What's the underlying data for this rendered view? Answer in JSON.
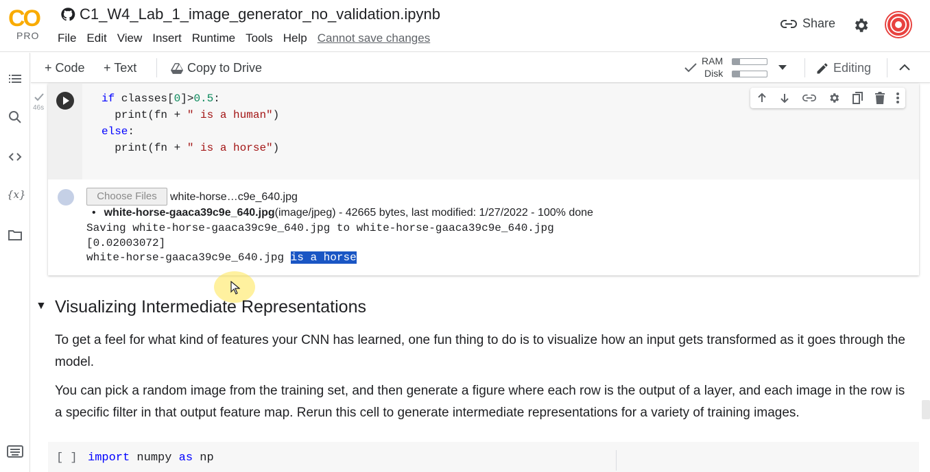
{
  "app": {
    "logo_text": "CO",
    "logo_sub": "PRO",
    "notebook_title": "C1_W4_Lab_1_image_generator_no_validation.ipynb"
  },
  "menu": [
    "File",
    "Edit",
    "View",
    "Insert",
    "Runtime",
    "Tools",
    "Help"
  ],
  "save_status": "Cannot save changes",
  "header_actions": {
    "share_label": "Share"
  },
  "toolbar": {
    "code_label": "+ Code",
    "text_label": "+ Text",
    "copy_label": "Copy to Drive",
    "ram_label": "RAM",
    "disk_label": "Disk",
    "editing_label": "Editing",
    "ram_usage": 0.22,
    "disk_usage": 0.22
  },
  "code_cell": {
    "exec_time": "46s",
    "lines": [
      "if classes[0]>0.5:",
      "  print(fn + \" is a human\")",
      "else:",
      "  print(fn + \" is a horse\")"
    ]
  },
  "output": {
    "choose_files_label": "Choose Files",
    "chosen_file": "white-horse…c9e_640.jpg",
    "upload_filename": "white-horse-gaaca39c9e_640.jpg",
    "upload_details": "(image/jpeg) - 42665 bytes, last modified: 1/27/2022 - 100% done",
    "saving_line": "Saving white-horse-gaaca39c9e_640.jpg to white-horse-gaaca39c9e_640.jpg",
    "prediction_line": "[0.02003072]",
    "result_prefix": "white-horse-gaaca39c9e_640.jpg ",
    "result_highlight": "is a horse"
  },
  "section": {
    "title": "Visualizing Intermediate Representations",
    "para1": "To get a feel for what kind of features your CNN has learned, one fun thing to do is to visualize how an input gets transformed as it goes through the model.",
    "para2": "You can pick a random image from the training set, and then generate a figure where each row is the output of a layer, and each image in the row is a specific filter in that output feature map. Rerun this cell to generate intermediate representations for a variety of training images."
  },
  "next_cell": {
    "bracket": "[ ]",
    "code_line": "import numpy as np"
  },
  "colors": {
    "accent": "#f9ab00",
    "selection": "#1a56c4",
    "avatar": "#e8423f"
  }
}
